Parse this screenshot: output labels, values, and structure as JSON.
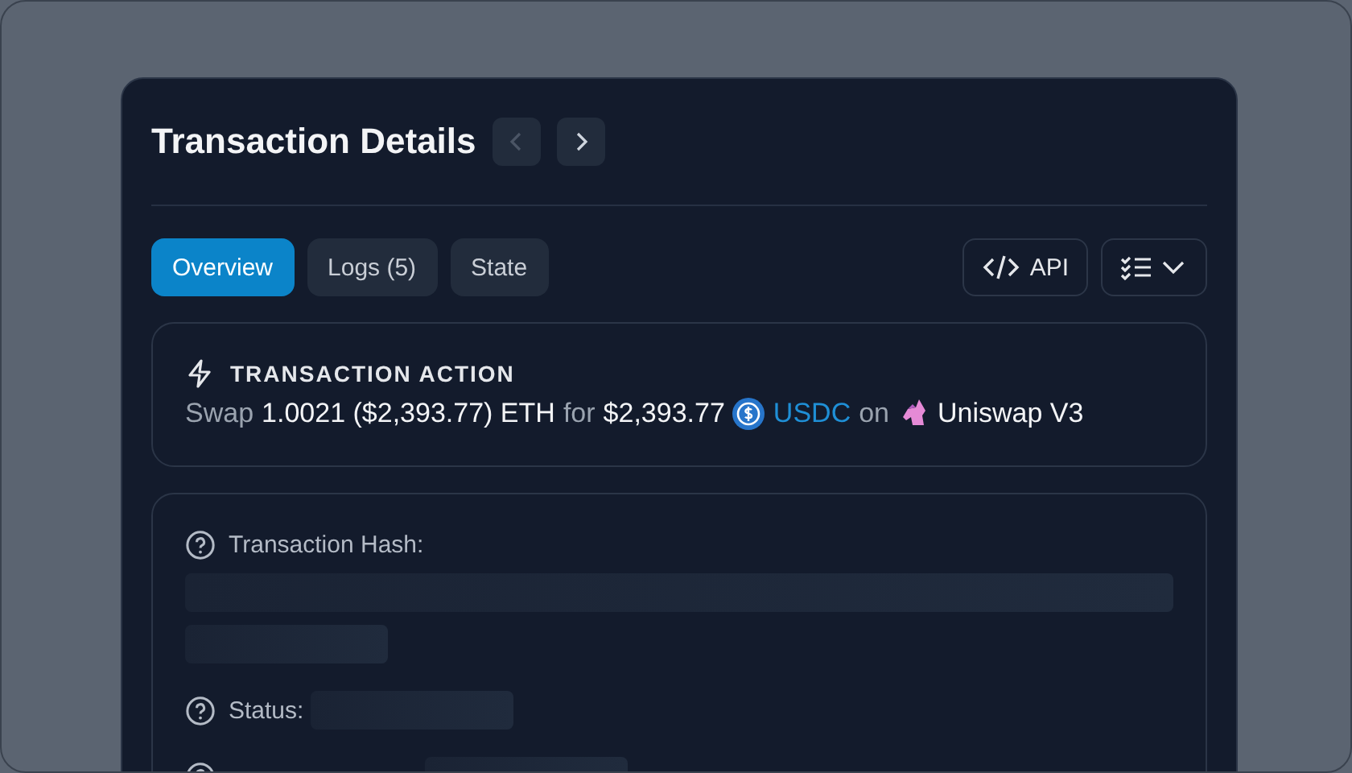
{
  "title": "Transaction Details",
  "nav": [
    {
      "kind": "prev",
      "disabled": true
    },
    {
      "kind": "next",
      "disabled": false
    }
  ],
  "tabs": [
    {
      "label": "Overview",
      "selected": true
    },
    {
      "label": "Logs (5)",
      "selected": false
    },
    {
      "label": "State",
      "selected": false
    }
  ],
  "api_button": "API",
  "action": {
    "heading": "TRANSACTION ACTION",
    "segments": [
      {
        "kind": "muted",
        "text": "Swap"
      },
      {
        "kind": "value",
        "text": "1.0021 ($2,393.77) ETH"
      },
      {
        "kind": "muted",
        "text": "for"
      },
      {
        "kind": "value",
        "text": "$2,393.77"
      },
      {
        "kind": "token",
        "text": "USDC"
      },
      {
        "kind": "muted",
        "text": "on"
      },
      {
        "kind": "dex",
        "text": "Uniswap V3"
      }
    ]
  },
  "details": [
    {
      "label": "Transaction Hash:",
      "kind": "block"
    },
    {
      "label": "Status:",
      "kind": "inline"
    },
    {
      "kind": "inline"
    }
  ]
}
